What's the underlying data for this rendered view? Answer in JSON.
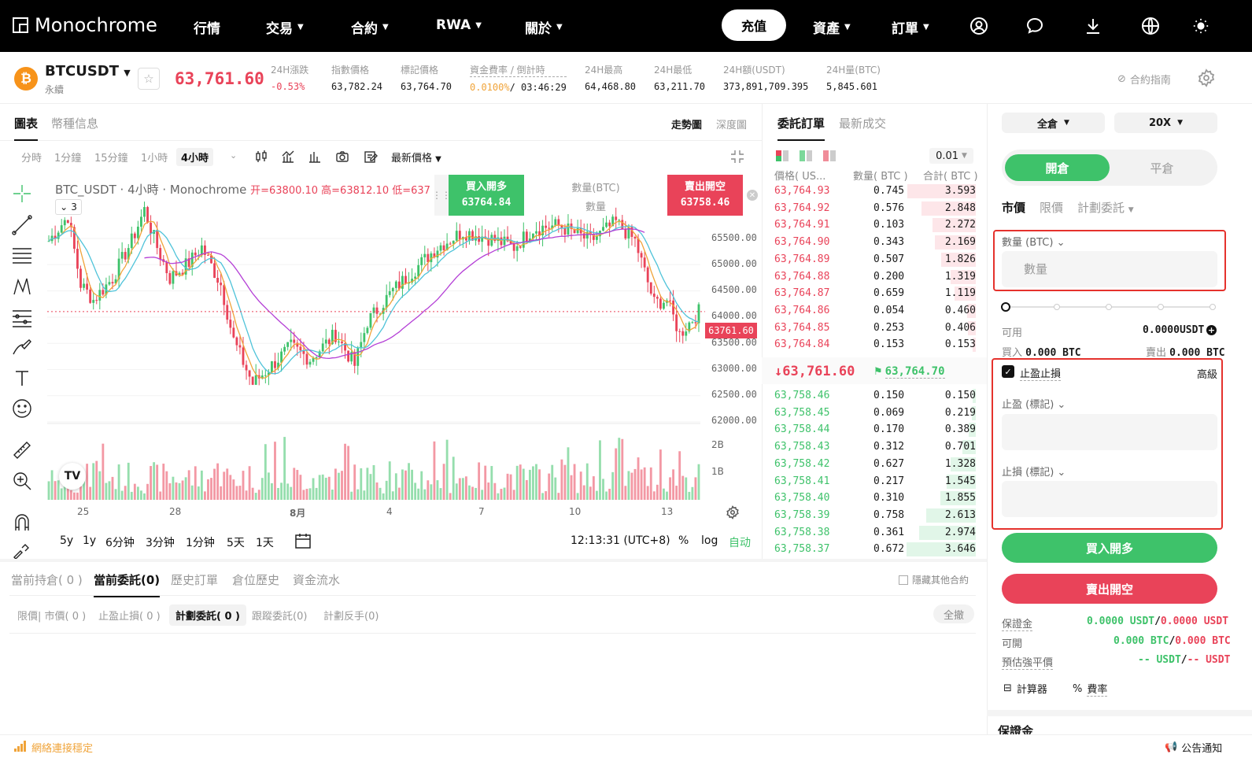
{
  "nav": {
    "brand": "Monochrome",
    "items": [
      {
        "label": "行情",
        "has_menu": false
      },
      {
        "label": "交易",
        "has_menu": true
      },
      {
        "label": "合約",
        "has_menu": true
      },
      {
        "label": "RWA",
        "has_menu": true
      },
      {
        "label": "關於",
        "has_menu": true
      }
    ],
    "deposit": "充值",
    "right_items": [
      {
        "label": "資產"
      },
      {
        "label": "訂單"
      }
    ],
    "icons": [
      "user-icon",
      "chat-icon",
      "download-icon",
      "globe-icon",
      "theme-icon"
    ]
  },
  "ticker": {
    "symbol": "BTCUSDT",
    "sub": "永續",
    "coin_letter": "₿",
    "last_price": "63,761.60",
    "stats": [
      {
        "label": "24H漲跌",
        "value": "-0.53%",
        "color": "#e94359"
      },
      {
        "label": "指數價格",
        "value": "63,782.24"
      },
      {
        "label": "標記價格",
        "value": "63,764.70"
      },
      {
        "label": "資金費率 / 倒計時",
        "value_a": "0.0100%",
        "value_b": "/ 03:46:29"
      },
      {
        "label": "24H最高",
        "value": "64,468.80"
      },
      {
        "label": "24H最低",
        "value": "63,211.70"
      },
      {
        "label": "24H額(USDT)",
        "value": "373,891,709.395"
      },
      {
        "label": "24H量(BTC)",
        "value": "5,845.601"
      }
    ],
    "guide": "合約指南"
  },
  "chart_panel": {
    "tabs": [
      "圖表",
      "幣種信息"
    ],
    "views": [
      "走勢圖",
      "深度圖"
    ],
    "intervals": [
      "分時",
      "1分鐘",
      "15分鐘",
      "1小時",
      "4小時"
    ],
    "active_interval": "4小時",
    "price_type": "最新價格",
    "legend_title": "BTC_USDT · 4小時 · Monochrome",
    "legend_ohlc": "开=63800.10  高=63812.10  低=637",
    "indicator_count": "3",
    "buy_label": "買入開多",
    "buy_price": "63764.84",
    "sell_label": "賣出開空",
    "sell_price": "63758.46",
    "qty_label": "數量(BTC)",
    "qty_placeholder": "數量",
    "price_tag": "63761.60",
    "ranges": [
      "5y",
      "1y",
      "6分钟",
      "3分钟",
      "1分钟",
      "5天",
      "1天"
    ],
    "clock": "12:13:31 (UTC+8)",
    "scale_opts": [
      "%",
      "log",
      "自动"
    ]
  },
  "chart_data": {
    "type": "candlestick",
    "y_ticks": [
      "65500.00",
      "65000.00",
      "64500.00",
      "64000.00",
      "63500.00",
      "63000.00",
      "62500.00",
      "62000.00"
    ],
    "volume_ticks": [
      "2B",
      "1B"
    ],
    "x_ticks": [
      "25",
      "28",
      "8月",
      "4",
      "7",
      "10",
      "13"
    ],
    "ylim": [
      62000,
      65800
    ],
    "last": 63761.6
  },
  "orderbook": {
    "tabs": [
      "委託訂單",
      "最新成交"
    ],
    "precision": "0.01",
    "headers": [
      "價格( US...",
      "數量( BTC )",
      "合計( BTC )"
    ],
    "asks": [
      [
        "63,764.93",
        "0.745",
        "3.593"
      ],
      [
        "63,764.92",
        "0.576",
        "2.848"
      ],
      [
        "63,764.91",
        "0.103",
        "2.272"
      ],
      [
        "63,764.90",
        "0.343",
        "2.169"
      ],
      [
        "63,764.89",
        "0.507",
        "1.826"
      ],
      [
        "63,764.88",
        "0.200",
        "1.319"
      ],
      [
        "63,764.87",
        "0.659",
        "1.119"
      ],
      [
        "63,764.86",
        "0.054",
        "0.460"
      ],
      [
        "63,764.85",
        "0.253",
        "0.406"
      ],
      [
        "63,764.84",
        "0.153",
        "0.153"
      ]
    ],
    "mid_price": "↓63,761.60",
    "mark_price": "63,764.70",
    "bids": [
      [
        "63,758.46",
        "0.150",
        "0.150"
      ],
      [
        "63,758.45",
        "0.069",
        "0.219"
      ],
      [
        "63,758.44",
        "0.170",
        "0.389"
      ],
      [
        "63,758.43",
        "0.312",
        "0.701"
      ],
      [
        "63,758.42",
        "0.627",
        "1.328"
      ],
      [
        "63,758.41",
        "0.217",
        "1.545"
      ],
      [
        "63,758.40",
        "0.310",
        "1.855"
      ],
      [
        "63,758.39",
        "0.758",
        "2.613"
      ],
      [
        "63,758.38",
        "0.361",
        "2.974"
      ],
      [
        "63,758.37",
        "0.672",
        "3.646"
      ]
    ]
  },
  "trade": {
    "margin_mode": "全倉",
    "leverage": "20X",
    "open": "開倉",
    "close": "平倉",
    "order_types": [
      "市價",
      "限價",
      "計劃委託"
    ],
    "qty_label": "數量 (BTC)",
    "qty_placeholder": "數量",
    "available_label": "可用",
    "available_value": "0.0000USDT",
    "buy_label": "買入",
    "buy_value": "0.000 BTC",
    "sell_label": "賣出",
    "sell_value": "0.000 BTC",
    "tpsl": "止盈止損",
    "advanced": "高級",
    "tp_label": "止盈 (標記)",
    "sl_label": "止損 (標記)",
    "buy_btn": "買入開多",
    "sell_btn": "賣出開空",
    "margin_label": "保證金",
    "margin_a": "0.0000 USDT",
    "margin_b": "0.0000 USDT",
    "avail2_label": "可開",
    "avail2_a": "0.000 BTC",
    "avail2_b": "0.000 BTC",
    "liq_label": "預估強平價",
    "liq_a": "-- USDT",
    "liq_b": "-- USDT",
    "calculator": "計算器",
    "rate": "費率",
    "margin_section": "保證金"
  },
  "orders": {
    "tabs": [
      "當前持倉( 0 )",
      "當前委託(0)",
      "歷史訂單",
      "倉位歷史",
      "資金流水"
    ],
    "hide_other": "隱藏其他合約",
    "subtabs": [
      "限價| 市價( 0 )",
      "止盈止損( 0 )",
      "計劃委託( 0 )",
      "跟蹤委託(0)",
      "計劃反手(0)"
    ],
    "cancel_all": "全撤"
  },
  "status": {
    "connection": "網絡連接穩定",
    "announce": "公告通知"
  },
  "colors": {
    "up": "#3ec26a",
    "down": "#e94359",
    "accent": "#000000"
  }
}
